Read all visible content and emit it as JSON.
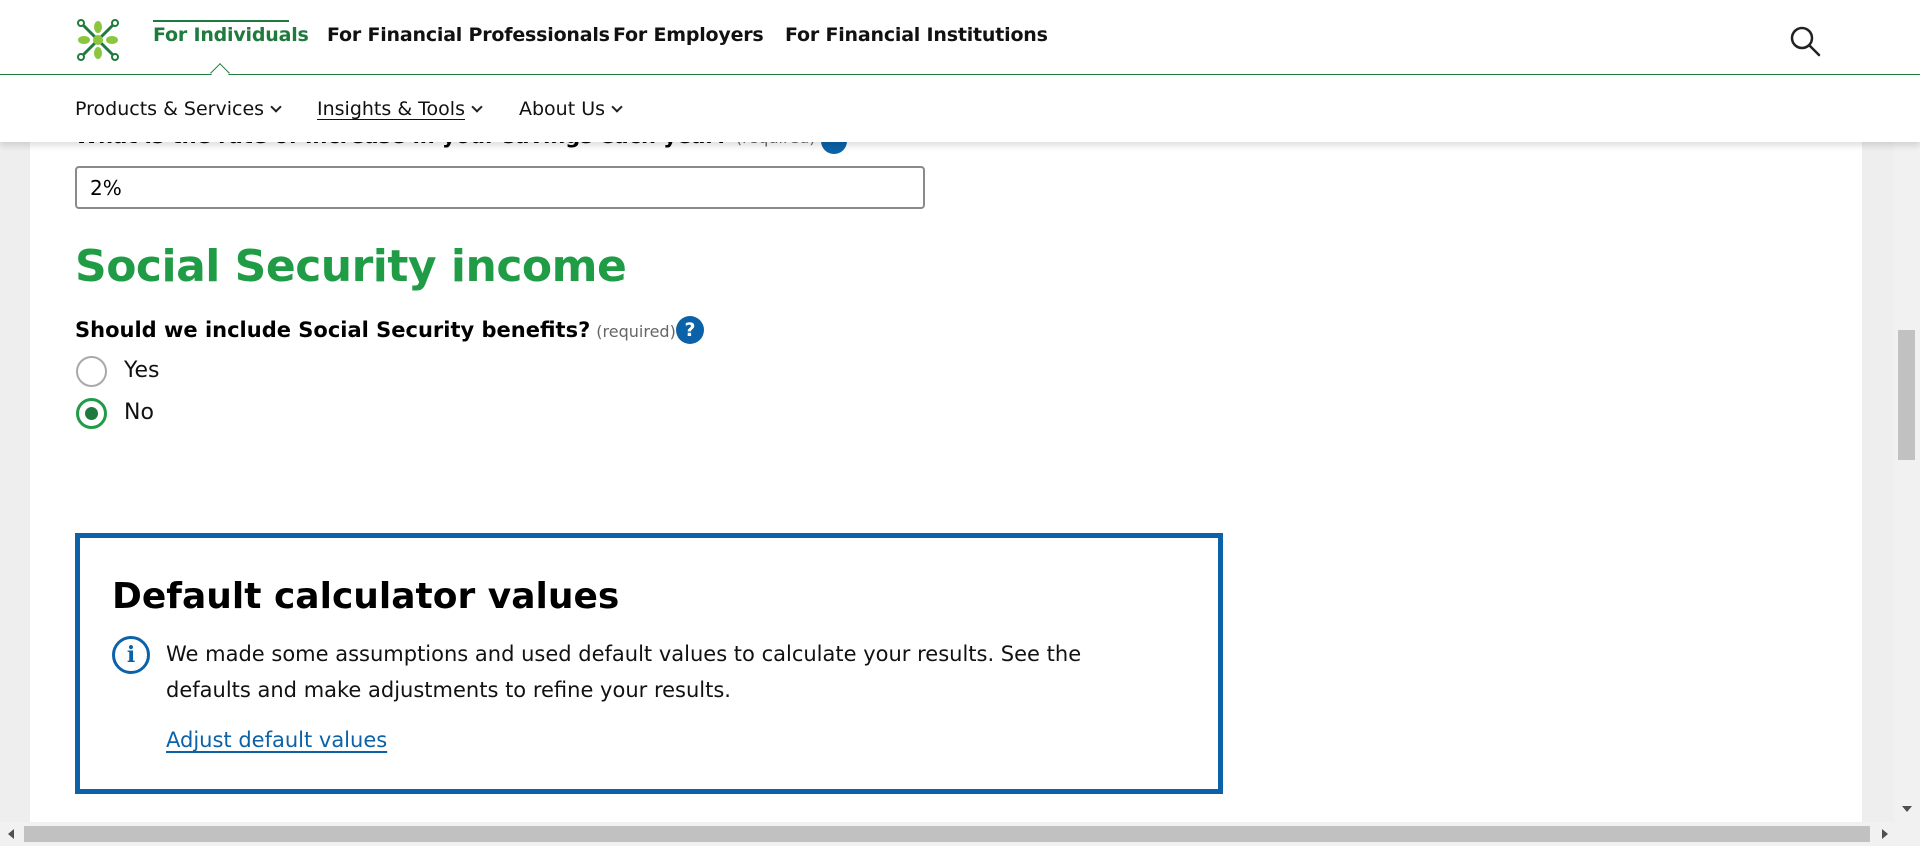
{
  "nav": {
    "top": [
      {
        "label": "For Individuals",
        "active": true
      },
      {
        "label": "For Financial Professionals"
      },
      {
        "label": "For Employers"
      },
      {
        "label": "For Financial Institutions"
      }
    ],
    "sub": [
      {
        "label": "Products & Services"
      },
      {
        "label": "Insights & Tools"
      },
      {
        "label": "About Us"
      }
    ],
    "search_icon": "search-icon",
    "logo_icon": "brand-logo-icon"
  },
  "form": {
    "partial_question": "What is the rate of increase in your savings each year?",
    "partial_required": "(required)",
    "savings_increase_value": "2%",
    "section_title": "Social Security income",
    "question": "Should we include Social Security benefits?",
    "required": "(required)",
    "help_glyph": "?",
    "options": [
      {
        "label": "Yes",
        "checked": false
      },
      {
        "label": "No",
        "checked": true
      }
    ]
  },
  "info_box": {
    "title": "Default calculator values",
    "icon": "info-icon",
    "icon_glyph": "i",
    "text": "We made some assumptions and used default values to calculate your results. See the defaults and make adjustments to refine your results.",
    "link": "Adjust default values"
  },
  "colors": {
    "brand_green": "#1f7a3d",
    "heading_green": "#1f9c45",
    "accent_blue": "#0b62a8"
  }
}
